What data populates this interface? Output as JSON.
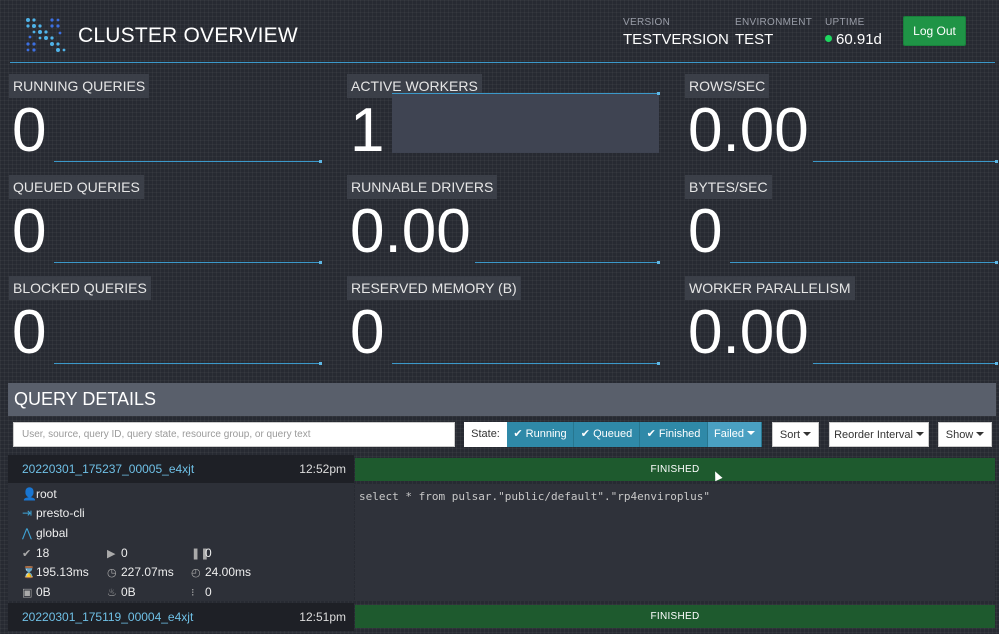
{
  "header": {
    "title": "CLUSTER OVERVIEW",
    "version_label": "VERSION",
    "version_value": "TESTVERSION",
    "environment_label": "ENVIRONMENT",
    "environment_value": "TEST",
    "uptime_label": "UPTIME",
    "uptime_value": "60.91d",
    "logout_label": "Log Out"
  },
  "tiles": [
    {
      "label": "RUNNING QUERIES",
      "value": "0"
    },
    {
      "label": "ACTIVE WORKERS",
      "value": "1"
    },
    {
      "label": "ROWS/SEC",
      "value": "0.00"
    },
    {
      "label": "QUEUED QUERIES",
      "value": "0"
    },
    {
      "label": "RUNNABLE DRIVERS",
      "value": "0.00"
    },
    {
      "label": "BYTES/SEC",
      "value": "0"
    },
    {
      "label": "BLOCKED QUERIES",
      "value": "0"
    },
    {
      "label": "RESERVED MEMORY (B)",
      "value": "0"
    },
    {
      "label": "WORKER PARALLELISM",
      "value": "0.00"
    }
  ],
  "query_details": {
    "title": "QUERY DETAILS",
    "search_placeholder": "User, source, query ID, query state, resource group, or query text",
    "state_label": "State:",
    "state_filters": [
      {
        "label": "Running"
      },
      {
        "label": "Queued"
      },
      {
        "label": "Finished"
      },
      {
        "label": "Failed"
      }
    ],
    "sort_label": "Sort",
    "reorder_label": "Reorder Interval",
    "show_label": "Show"
  },
  "queries": [
    {
      "id": "20220301_175237_00005_e4xjt",
      "time": "12:52pm",
      "state": "FINISHED",
      "user": "root",
      "source": "presto-cli",
      "resource_group": "global",
      "query_text": "select * from pulsar.\"public/default\".\"rp4enviroplus\"",
      "completed_splits": "18",
      "running_splits": "0",
      "blocked_splits": "0",
      "wall_time": "195.13ms",
      "elapsed_time": "227.07ms",
      "cpu_time": "24.00ms",
      "current_memory": "0B",
      "peak_memory": "0B",
      "cumulative_memory": "0"
    },
    {
      "id": "20220301_175119_00004_e4xjt",
      "time": "12:51pm",
      "state": "FINISHED"
    }
  ],
  "colors": {
    "accent_line": "#3b98c9",
    "logout_green": "#1f9446",
    "finished_green": "#1e5a2e",
    "state_button_blue": "#2f89a8",
    "query_id_link": "#6fc0e6"
  }
}
